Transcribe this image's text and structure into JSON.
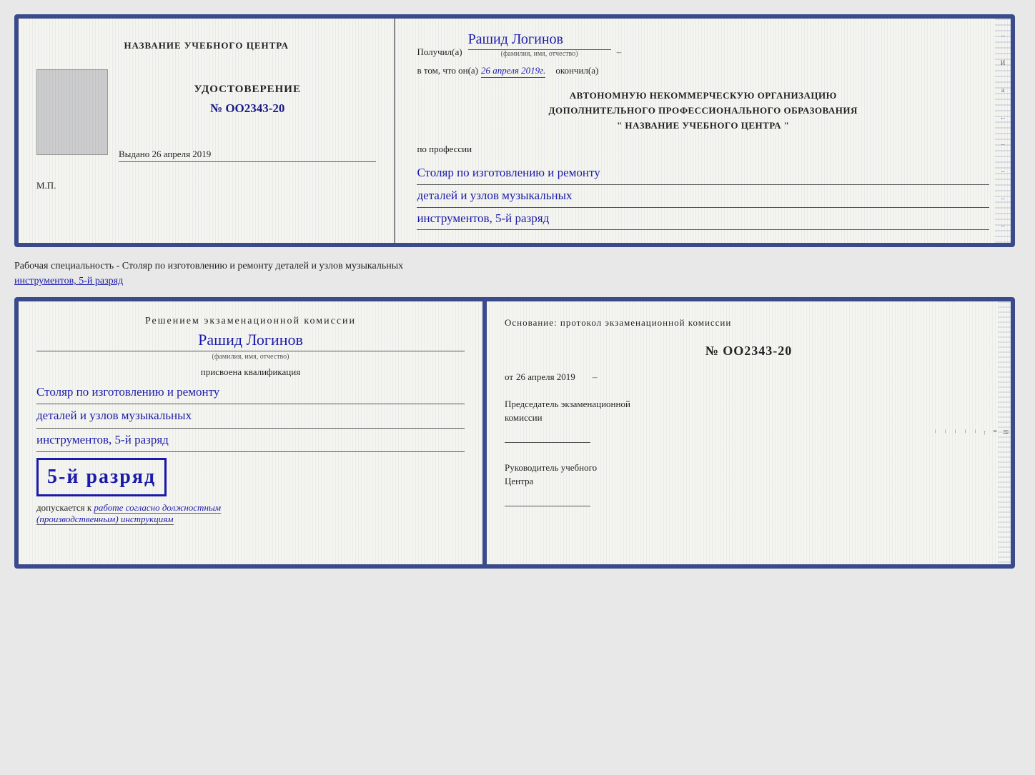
{
  "page": {
    "background": "#e8e8e8"
  },
  "cert_front": {
    "left": {
      "school_name": "НАЗВАНИЕ УЧЕБНОГО ЦЕНТРА",
      "cert_title": "УДОСТОВЕРЕНИЕ",
      "cert_number": "№ OO2343-20",
      "issued_label": "Выдано",
      "issued_date": "26 апреля 2019",
      "mp_label": "М.П."
    },
    "right": {
      "received_label": "Получил(а)",
      "recipient_name": "Рашид Логинов",
      "name_sublabel": "(фамилия, имя, отчество)",
      "dash": "–",
      "in_that_label": "в том, что он(а)",
      "completion_date": "26 апреля 2019г.",
      "finished_label": "окончил(а)",
      "org_line1": "АВТОНОМНУЮ НЕКОММЕРЧЕСКУЮ ОРГАНИЗАЦИЮ",
      "org_line2": "ДОПОЛНИТЕЛЬНОГО ПРОФЕССИОНАЛЬНОГО ОБРАЗОВАНИЯ",
      "org_line3": "\"   НАЗВАНИЕ УЧЕБНОГО ЦЕНТРА   \"",
      "profession_label": "по профессии",
      "profession_line1": "Столяр по изготовлению и ремонту",
      "profession_line2": "деталей и узлов музыкальных",
      "profession_line3": "инструментов, 5-й разряд"
    }
  },
  "between_text": {
    "main": "Рабочая специальность - Столяр по изготовлению и ремонту деталей и узлов музыкальных",
    "underline_part": "инструментов, 5-й разряд"
  },
  "cert_back": {
    "left": {
      "decision_text": "Решением  экзаменационной  комиссии",
      "person_name": "Рашид Логинов",
      "name_sublabel": "(фамилия, имя, отчество)",
      "qualification_label": "присвоена квалификация",
      "qual_line1": "Столяр по изготовлению и ремонту",
      "qual_line2": "деталей и узлов музыкальных",
      "qual_line3": "инструментов, 5-й разряд",
      "rank_text": "5-й разряд",
      "admitted_label": "допускается к",
      "admitted_value": "работе согласно должностным",
      "admitted_value2": "(производственным) инструкциям"
    },
    "right": {
      "osnov_label": "Основание: протокол экзаменационной  комиссии",
      "number_label": "№  OO2343-20",
      "from_label": "от",
      "from_date": "26 апреля 2019",
      "chairman_label": "Председатель экзаменационной",
      "chairman_label2": "комиссии",
      "director_label": "Руководитель учебного",
      "director_label2": "Центра",
      "side_chars": [
        "И",
        "а",
        "←",
        "–",
        "–",
        "–",
        "–",
        "–"
      ]
    }
  }
}
